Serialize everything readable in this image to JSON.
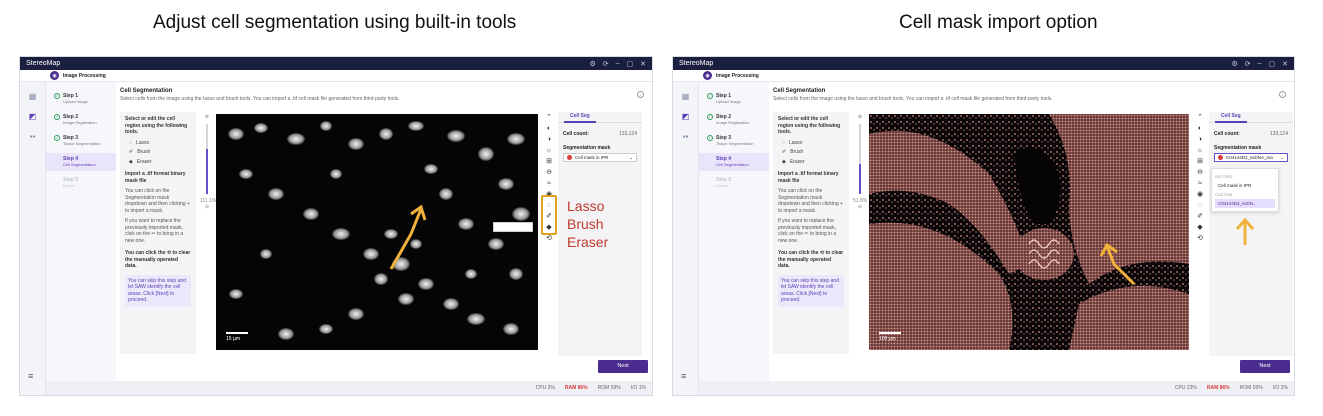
{
  "captions": {
    "left": "Adjust cell segmentation using built-in tools",
    "right": "Cell mask import option"
  },
  "app": {
    "window_title": "StereoMap",
    "tab": "Image Processing",
    "steps": [
      {
        "title": "Step 1",
        "sub": "Upload Image",
        "state": "done"
      },
      {
        "title": "Step 2",
        "sub": "Image Registration",
        "state": "done"
      },
      {
        "title": "Step 3",
        "sub": "Tissue Segmentation",
        "state": "done"
      },
      {
        "title": "Step 4",
        "sub": "Cell Segmentation",
        "state": "active"
      },
      {
        "title": "Step 5",
        "sub": "Export",
        "state": "todo"
      }
    ],
    "main_title": "Cell Segmentation",
    "main_desc": "Select cells from the image using the lasso and brush tools. You can import a .tif cell mask file generated from third-party tools.",
    "tools_header": "Select or edit the cell region using the following tools.",
    "tools": [
      "Lasso",
      "Brush",
      "Eraser"
    ],
    "import_header": "Import a .tif format binary mask file",
    "import_para1": "You can click on the Segmentation mask dropdown and then clicking + to import a mask.",
    "import_para2": "If you want to replace the previously imported mask, click on the ✏ to bring in a new one.",
    "clear_text": "You can click the ⟲ to clear the manually operated data.",
    "tip": "You can skip this step and let SAW identify the cell areas. Click [Next] to proceed.",
    "right_tab": "Cell Seg",
    "cell_count_label": "Cell count:",
    "cell_count_value": "133,124",
    "seg_mask_label": "Segmentation mask",
    "seg_mask_value_left": "Cell mask in IPR",
    "seg_mask_value_right": "C04144D2_ssDNA_ma",
    "dropdown_record_caption": "RECORD",
    "dropdown_record_item": "Cell mask in IPR",
    "dropdown_custom_caption": "CUSTOM",
    "dropdown_custom_item": "C04144D2_ssDN...",
    "next_label": "Next",
    "scale_left": "15 µm",
    "scale_right": "100 µm",
    "zoom_left": "111.1%",
    "zoom_right": "51.8%",
    "status_left": {
      "cpu": "CPU  2%",
      "ram": "RAM  86%",
      "rom": "ROM  59%",
      "io": "I/O  1%"
    },
    "status_right": {
      "cpu": "CPU  23%",
      "ram": "RAM  86%",
      "rom": "ROM  59%",
      "io": "I/O  2%"
    }
  },
  "annotations": {
    "lasso": "Lasso",
    "brush": "Brush",
    "eraser": "Eraser"
  },
  "colors": {
    "accent": "#4a2d8f",
    "titlebar": "#1b1f3f",
    "annotation_box": "#e0a21c",
    "annotation_text": "#c0392b",
    "arrow": "#f0b23a"
  }
}
